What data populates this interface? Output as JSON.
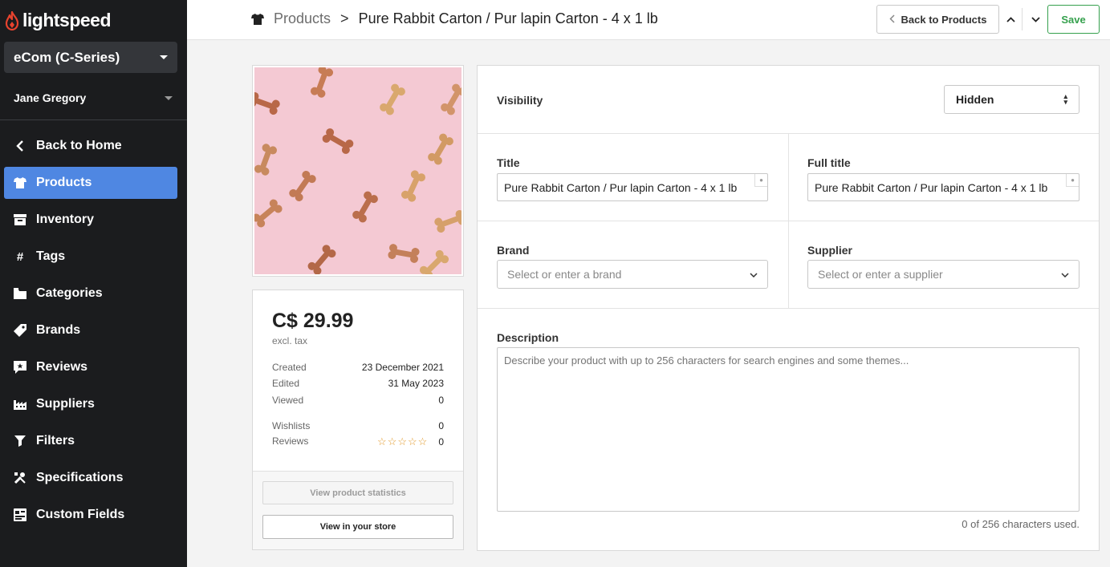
{
  "brand": {
    "name": "lightspeed",
    "accent": "#e8432e"
  },
  "sidebar": {
    "store": "eCom (C-Series)",
    "user": "Jane Gregory",
    "items": [
      {
        "label": "Back to Home",
        "icon": "chevron-left-icon"
      },
      {
        "label": "Products",
        "icon": "shirt-icon",
        "active": true
      },
      {
        "label": "Inventory",
        "icon": "inventory-icon"
      },
      {
        "label": "Tags",
        "icon": "hash-icon"
      },
      {
        "label": "Categories",
        "icon": "folder-icon"
      },
      {
        "label": "Brands",
        "icon": "tag-icon"
      },
      {
        "label": "Reviews",
        "icon": "review-icon"
      },
      {
        "label": "Suppliers",
        "icon": "factory-icon"
      },
      {
        "label": "Filters",
        "icon": "filter-icon"
      },
      {
        "label": "Specifications",
        "icon": "tools-icon"
      },
      {
        "label": "Custom Fields",
        "icon": "custom-fields-icon"
      }
    ]
  },
  "topbar": {
    "breadcrumb_root": "Products",
    "breadcrumb_sep": ">",
    "product_title": "Pure Rabbit Carton / Pur lapin Carton - 4 x 1 lb",
    "back_label": "Back to Products",
    "save_label": "Save"
  },
  "summary": {
    "price": "C$ 29.99",
    "tax_note": "excl. tax",
    "created_label": "Created",
    "created": "23 December 2021",
    "edited_label": "Edited",
    "edited": "31 May 2023",
    "viewed_label": "Viewed",
    "viewed": "0",
    "wishlists_label": "Wishlists",
    "wishlists": "0",
    "reviews_label": "Reviews",
    "reviews": "0",
    "rating": 0,
    "stats_label": "View product statistics",
    "store_label": "View in your store"
  },
  "form": {
    "visibility_label": "Visibility",
    "visibility_value": "Hidden",
    "title_label": "Title",
    "title_value": "Pure Rabbit Carton / Pur lapin Carton  - 4 x 1 lb",
    "full_title_label": "Full title",
    "full_title_value": "Pure Rabbit Carton / Pur lapin Carton  - 4 x 1 lb",
    "brand_label": "Brand",
    "brand_placeholder": "Select or enter a brand",
    "supplier_label": "Supplier",
    "supplier_placeholder": "Select or enter a supplier",
    "description_label": "Description",
    "description_placeholder": "Describe your product with up to 256 characters for search engines and some themes...",
    "char_count": "0 of 256 characters used."
  }
}
